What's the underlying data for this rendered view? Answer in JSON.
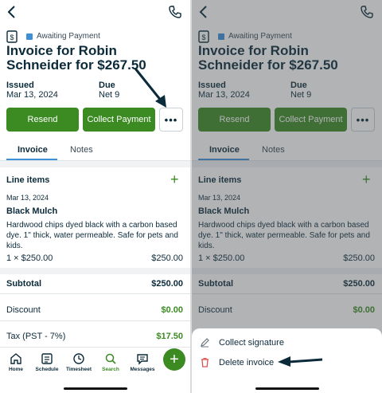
{
  "invoice": {
    "status": "Awaiting Payment",
    "title": "Invoice for Robin Schneider for $267.50",
    "issued_label": "Issued",
    "issued_value": "Mar 13, 2024",
    "due_label": "Due",
    "due_value": "Net 9"
  },
  "actions": {
    "resend": "Resend",
    "collect_payment": "Collect Payment",
    "more": "•••"
  },
  "tabs": [
    {
      "label": "Invoice",
      "active": true
    },
    {
      "label": "Notes",
      "active": false
    }
  ],
  "line_items": {
    "heading": "Line items",
    "add": "+",
    "items": [
      {
        "date": "Mar 13, 2024",
        "name": "Black Mulch",
        "description": "Hardwood chips dyed black with a carbon based dye. 1\" thick, water permeable. Safe for pets and kids.",
        "qty_price": "1 × $250.00",
        "total": "$250.00"
      }
    ]
  },
  "totals": {
    "subtotal_label": "Subtotal",
    "subtotal_value": "$250.00",
    "discount_label": "Discount",
    "discount_value": "$0.00",
    "tax_label": "Tax (PST - 7%)",
    "tax_value": "$17.50"
  },
  "nav": {
    "items": [
      {
        "label": "Home",
        "icon": "home-icon"
      },
      {
        "label": "Schedule",
        "icon": "schedule-icon"
      },
      {
        "label": "Timesheet",
        "icon": "clock-icon"
      },
      {
        "label": "Search",
        "icon": "search-icon",
        "active": true
      },
      {
        "label": "Messages",
        "icon": "messages-icon"
      }
    ],
    "fab": "+"
  },
  "sheet": {
    "collect_signature": "Collect signature",
    "delete_invoice": "Delete invoice"
  },
  "colors": {
    "accent_green": "#3b8a22",
    "status_blue": "#3e8fd6",
    "text_navy": "#0b2a3a",
    "danger_red": "#d9534f"
  }
}
